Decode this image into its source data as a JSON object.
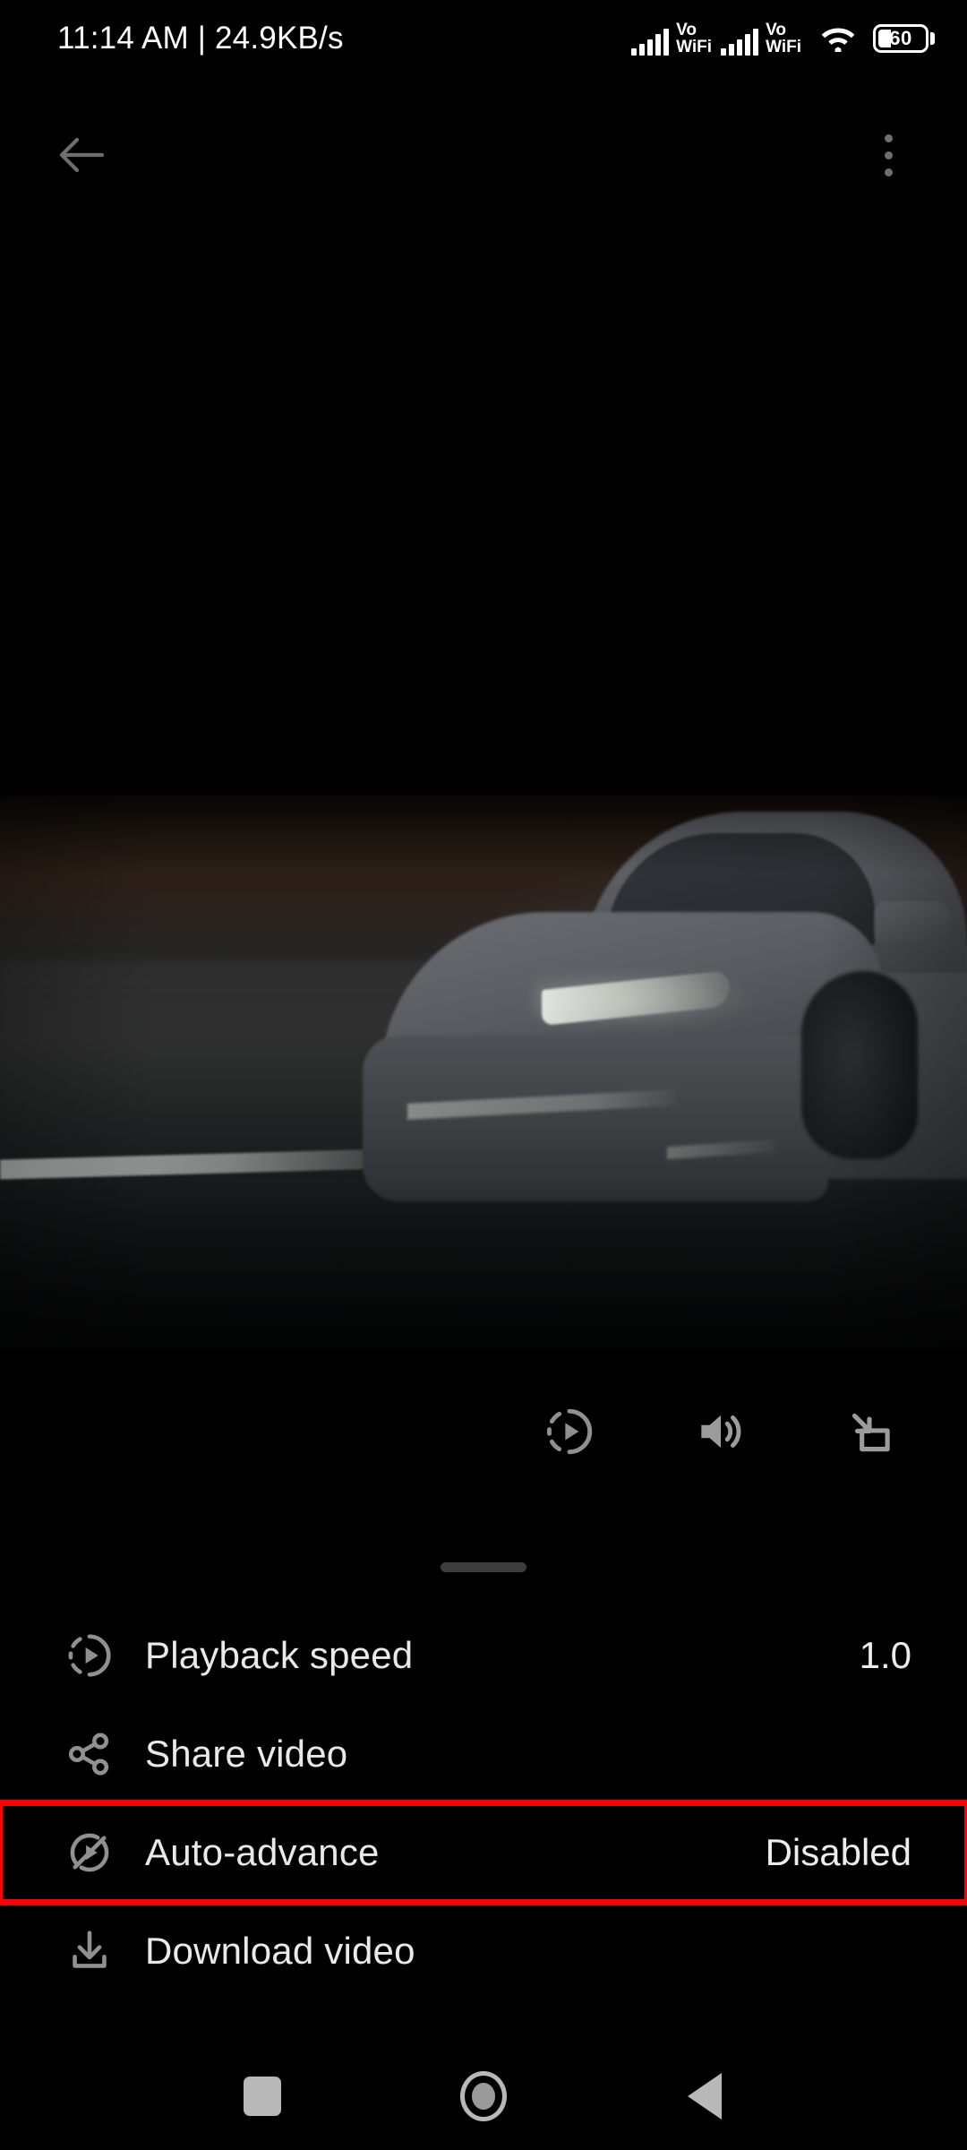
{
  "status_bar": {
    "time_and_network": "11:14 AM | 24.9KB/s",
    "sim1_label_top": "Vo",
    "sim1_label_bottom": "WiFi",
    "sim2_label_top": "Vo",
    "sim2_label_bottom": "WiFi",
    "wifi_icon": "wifi-icon",
    "battery_level": "60"
  },
  "app_bar": {
    "back_icon": "back-arrow-icon",
    "overflow_icon": "overflow-menu-icon"
  },
  "video": {
    "description": "dark night video frame of a grey electric car on a road",
    "surface_name": "video-surface"
  },
  "player_controls": [
    {
      "name": "playback-speed-icon",
      "label": "Playback speed"
    },
    {
      "name": "volume-icon",
      "label": "Volume"
    },
    {
      "name": "picture-in-picture-icon",
      "label": "Picture in picture"
    }
  ],
  "bottom_sheet": {
    "drag_handle": "sheet-drag-handle",
    "items": [
      {
        "icon": "playback-speed-icon",
        "label": "Playback speed",
        "value": "1.0",
        "highlighted": false
      },
      {
        "icon": "share-icon",
        "label": "Share video",
        "value": "",
        "highlighted": false
      },
      {
        "icon": "auto-advance-off-icon",
        "label": "Auto-advance",
        "value": "Disabled",
        "highlighted": true
      },
      {
        "icon": "download-icon",
        "label": "Download video",
        "value": "",
        "highlighted": false
      }
    ]
  },
  "nav_bar": {
    "recents_label": "Recents",
    "home_label": "Home",
    "back_label": "Back"
  },
  "colors": {
    "background": "#000000",
    "highlight_border": "#fe0000",
    "text_primary": "#e9e9e9",
    "icon_grey": "#8e9190"
  }
}
